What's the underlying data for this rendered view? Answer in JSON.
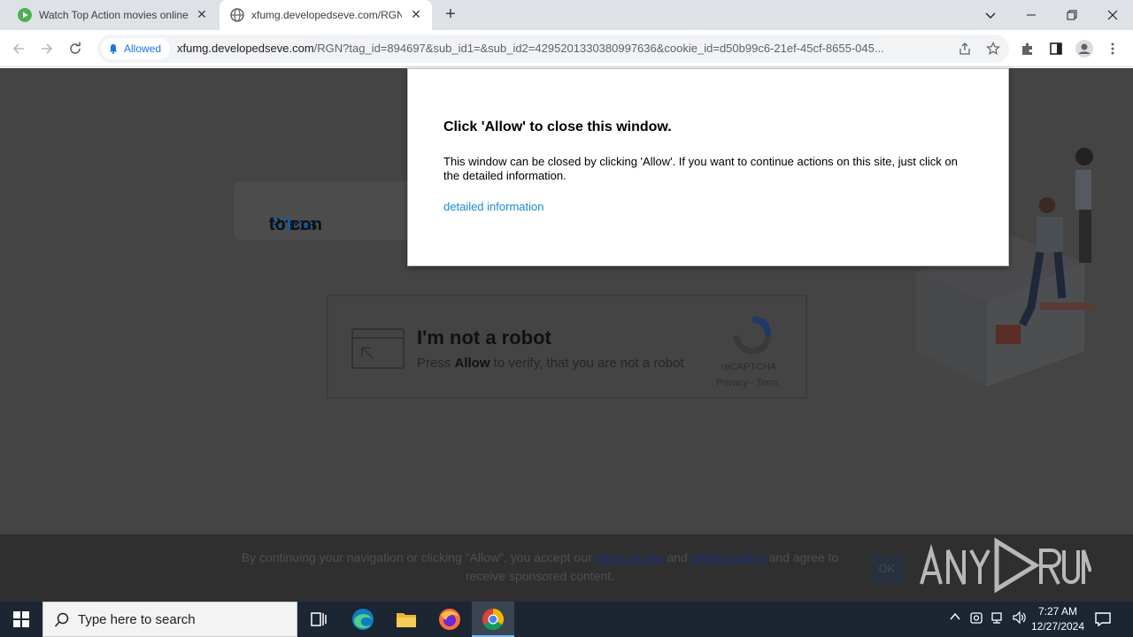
{
  "browser": {
    "tabs": [
      {
        "title": "Watch Top Action movies online",
        "favicon": "play-icon",
        "favicon_color": "#4caf50",
        "active": false
      },
      {
        "title": "xfumg.developedseve.com/RGN",
        "favicon": "globe-icon",
        "active": true
      }
    ],
    "close_glyph": "✕",
    "new_tab_glyph": "+",
    "address": {
      "permission_chip": "Allowed",
      "url_host": "xfumg.developedseve.com",
      "url_path": "/RGN?tag_id=894697&sub_id1=&sub_id2=4295201330380997636&cookie_id=d50b99c6-21ef-45cf-8655-045..."
    }
  },
  "page": {
    "press_card": {
      "prefix": "Press ",
      "allow": "Allow",
      "suffix": " to con"
    },
    "robot": {
      "title": "I'm not a robot",
      "sub_prefix": "Press ",
      "sub_bold": "Allow",
      "sub_suffix": " to verify, that you are not a robot",
      "recaptcha_label": "reCAPTCHA",
      "recaptcha_links": "Privacy - Term"
    },
    "consent": {
      "text_1": "By continuing your navigation or clicking \"Allow\", you accept our ",
      "terms": "terms of use ",
      "text_2": "and ",
      "privacy": "privacy policy ",
      "text_3": "and agree to receive sponsored content.",
      "ok": "OK"
    },
    "colors": {
      "page_bg": "#444444",
      "link": "#1a8ad4",
      "allow_blue": "#1a5a9a"
    }
  },
  "modal": {
    "title": "Click 'Allow' to close this window.",
    "body": "This window can be closed by clicking 'Allow'. If you want to continue actions on this site, just click on the detailed information.",
    "link": "detailed information"
  },
  "taskbar": {
    "search_placeholder": "Type here to search",
    "apps": [
      "task-view-icon",
      "edge-icon",
      "file-explorer-icon",
      "firefox-icon",
      "chrome-icon"
    ],
    "time": "7:27 AM",
    "date": "12/27/2024"
  }
}
